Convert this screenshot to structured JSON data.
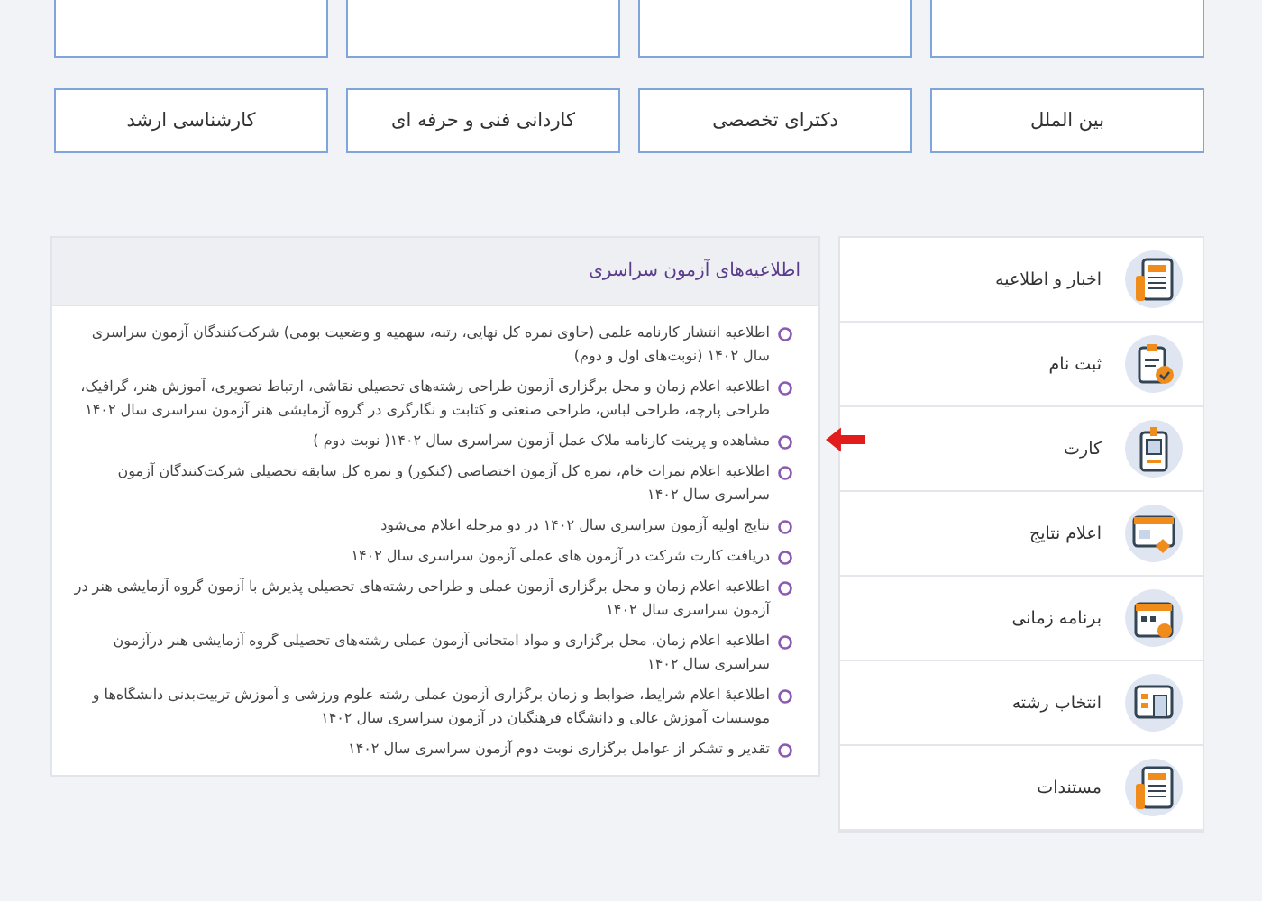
{
  "category_buttons": [
    {
      "label": "بین الملل"
    },
    {
      "label": "دکترای تخصصی"
    },
    {
      "label": "کاردانی فنی و حرفه ای"
    },
    {
      "label": "کارشناسی ارشد"
    }
  ],
  "notices_panel": {
    "title": "اطلاعیه‌های آزمون سراسری",
    "items": [
      {
        "text": "اطلاعیه انتشار کارنامه علمی (حاوی نمره کل نهایی، رتبه، سهمیه و وضعیت بومی) شرکت‌کنندگان آزمون سراسری سال ۱۴۰۲ (نوبت‌های اول و دوم)",
        "pointed": false
      },
      {
        "text": "اطلاعیه اعلام زمان و محل برگزاری آزمون طراحی رشته‌های تحصیلی نقاشی، ارتباط تصویری، آموزش هنر، گرافیک، طراحی پارچه، طراحی لباس، طراحی صنعتی و کتابت و نگارگری در گروه آزمایشی هنر آزمون سراسری سال ۱۴۰۲",
        "pointed": false
      },
      {
        "text": "مشاهده و پرینت کارنامه ملاک عمل آزمون سراسری سال ۱۴۰۲( نوبت دوم )",
        "pointed": true
      },
      {
        "text": "اطلاعیه اعلام نمرات خام، نمره کل آزمون اختصاصی (کنکور) و نمره کل سابقه تحصیلی شرکت‌کنندگان آزمون سراسری سال ۱۴۰۲",
        "pointed": false
      },
      {
        "text": "نتایج اولیه آزمون سراسری سال ۱۴۰۲ در دو مرحله اعلام می‌شود",
        "pointed": false
      },
      {
        "text": "دریافت کارت شرکت در آزمون های عملی آزمون سراسری سال ۱۴۰۲",
        "pointed": false
      },
      {
        "text": "اطلاعیه اعلام زمان و محل برگزاری آزمون عملی و طراحی رشته‌های تحصیلی پذیرش با آزمون گروه آزمایشی هنر در آزمون سراسری سال ۱۴۰۲",
        "pointed": false
      },
      {
        "text": "اطلاعیه اعلام زمان، محل برگزاری و مواد امتحانی آزمون عملی رشته‌های تحصیلی گروه آزمایشی هنر درآزمون سراسری سال ۱۴۰۲",
        "pointed": false
      },
      {
        "text": "اطلاعیهٔ اعلام شرایط، ضوابط و زمان برگزاری آزمون عملی رشته علوم ورزشی و آموزش تربیت‌بدنی دانشگاه‌ها و موسسات آموزش عالی و دانشگاه فرهنگیان در آزمون سراسری سال ۱۴۰۲",
        "pointed": false
      },
      {
        "text": "تقدیر و تشکر از عوامل برگزاری نوبت دوم آزمون سراسری سال ۱۴۰۲",
        "pointed": false
      }
    ]
  },
  "sidebar": {
    "items": [
      {
        "label": "اخبار و اطلاعیه"
      },
      {
        "label": "ثبت نام"
      },
      {
        "label": "کارت"
      },
      {
        "label": "اعلام نتایج"
      },
      {
        "label": "برنامه زمانی"
      },
      {
        "label": "انتخاب رشته"
      },
      {
        "label": "مستندات"
      }
    ]
  }
}
